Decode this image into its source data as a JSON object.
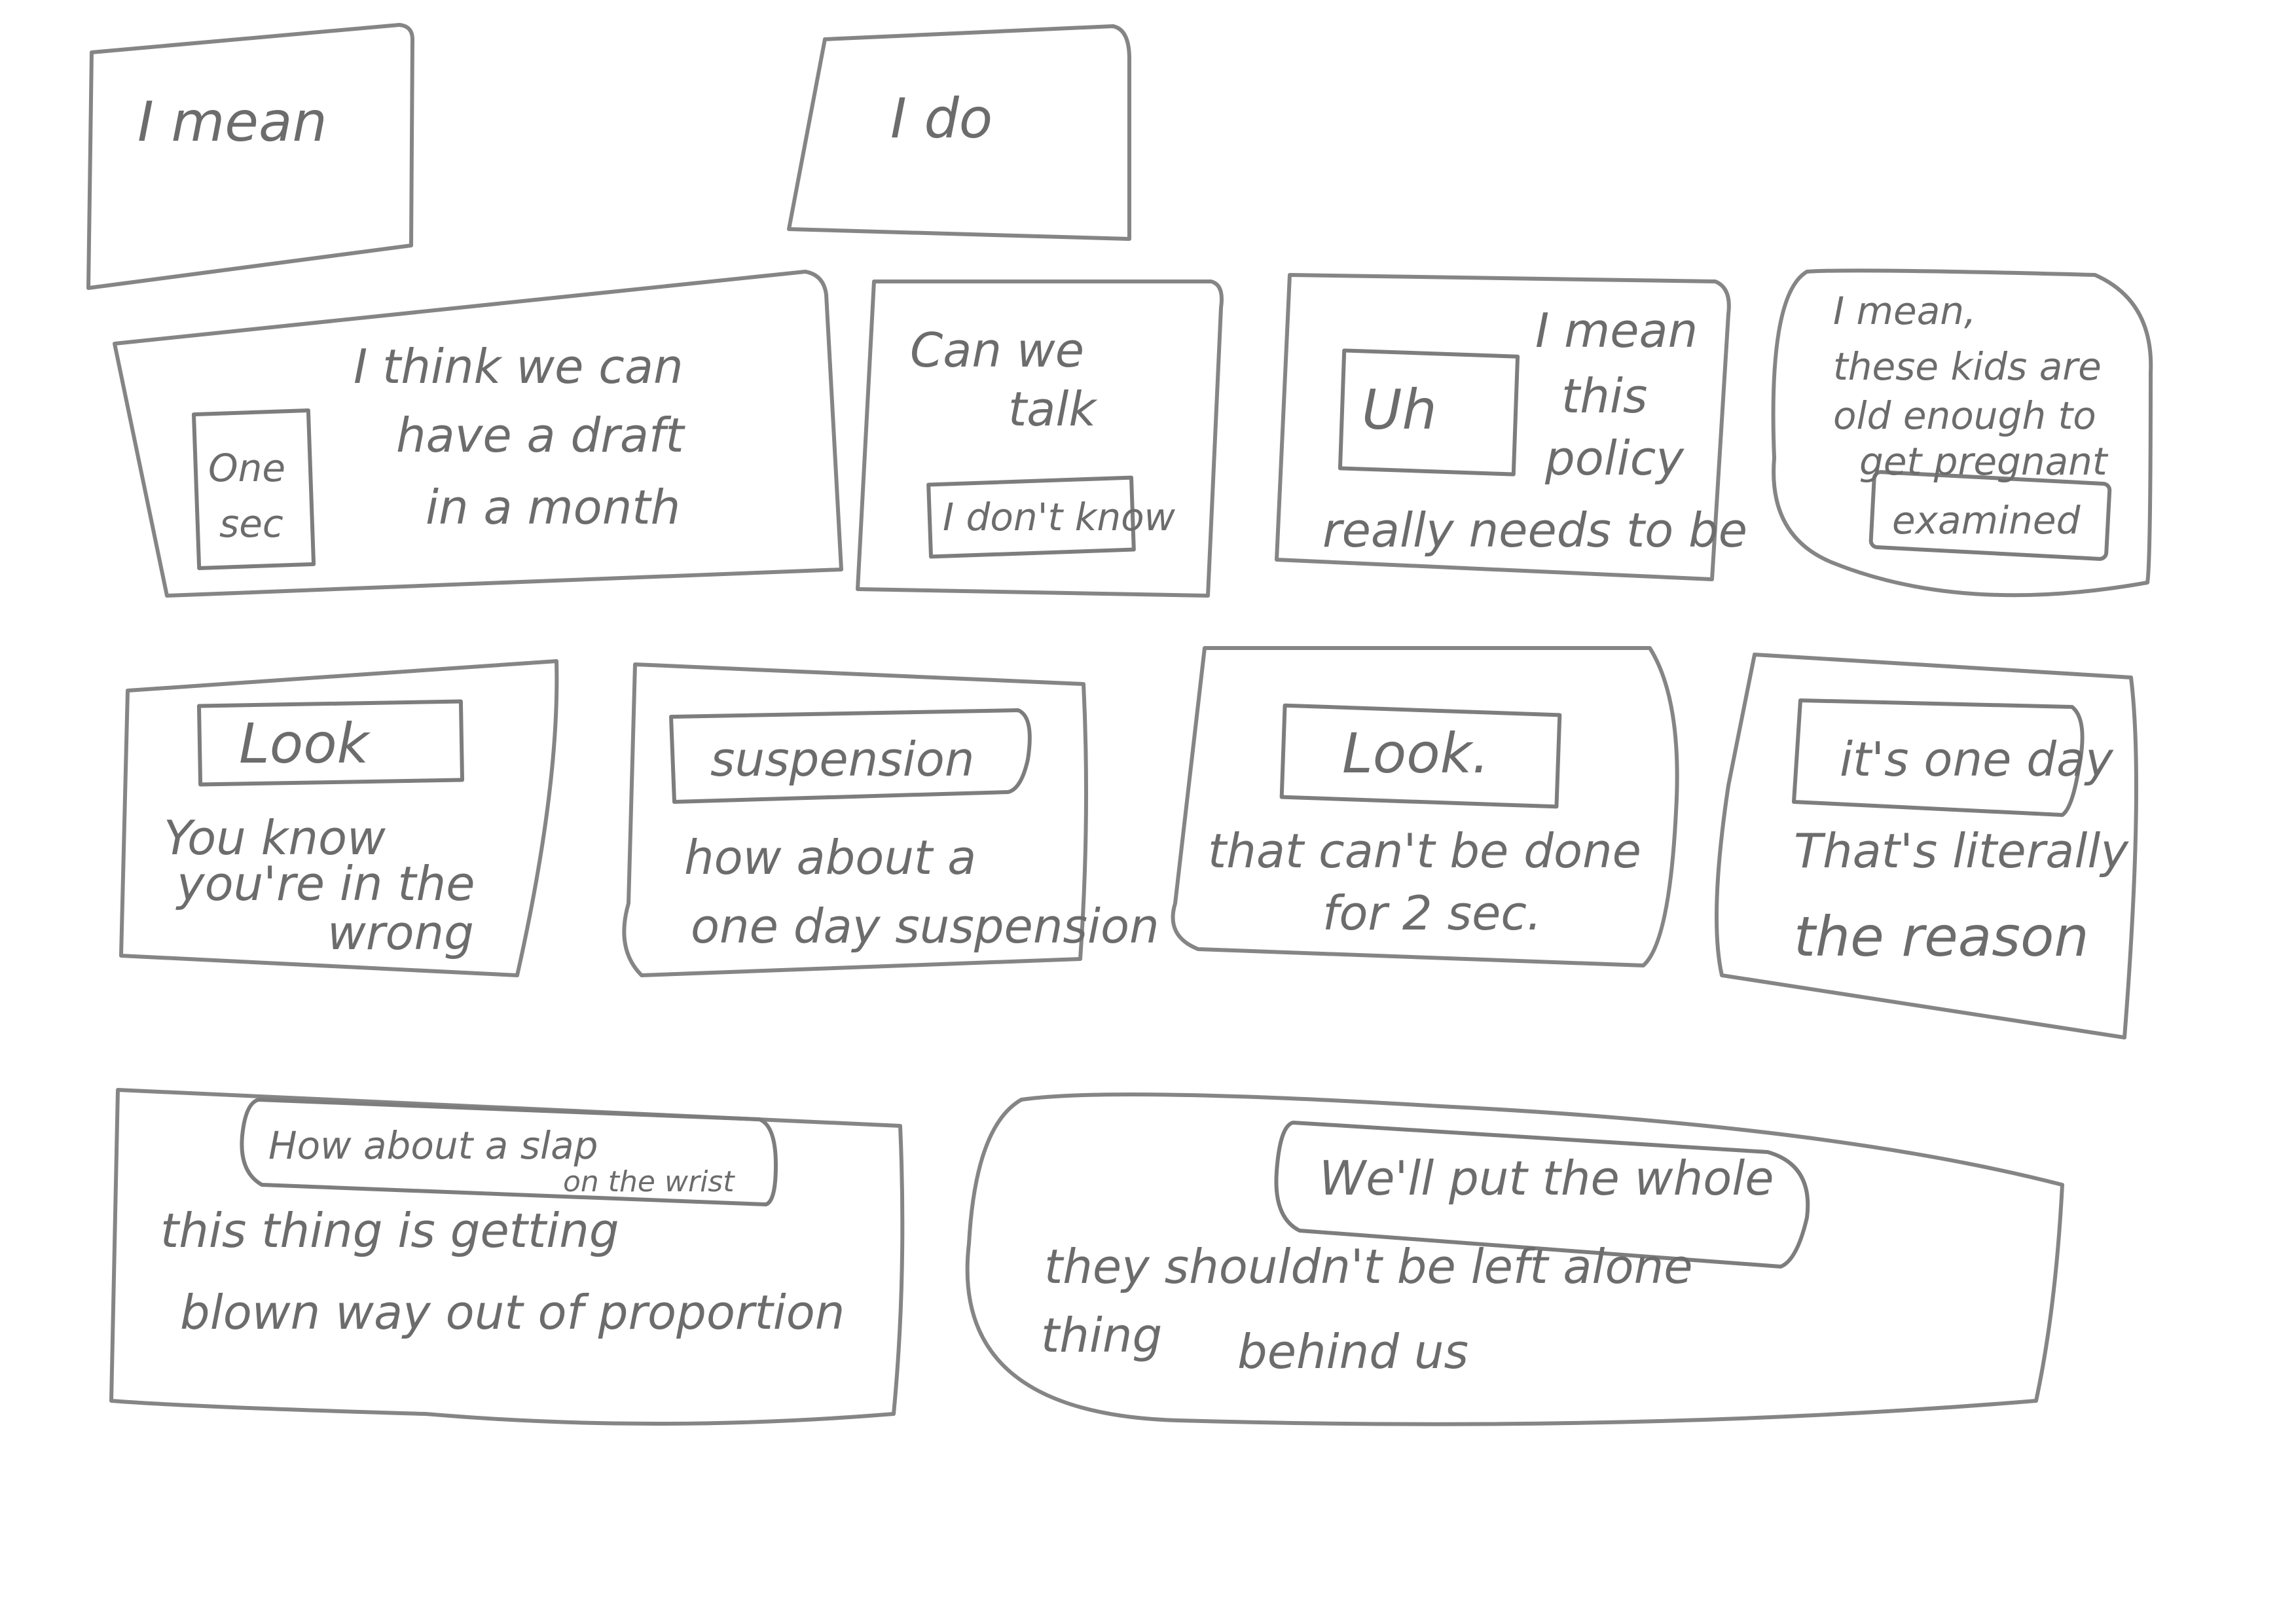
{
  "panels": [
    {
      "id": "p1",
      "lines": [
        "I mean"
      ]
    },
    {
      "id": "p2",
      "lines": [
        "I do"
      ]
    },
    {
      "id": "p3",
      "lines": [
        "I think we can",
        "have a draft",
        "in a month"
      ],
      "inset": [
        "One",
        "sec"
      ]
    },
    {
      "id": "p4",
      "lines": [
        "Can we",
        "talk"
      ],
      "inset": [
        "I don't know"
      ]
    },
    {
      "id": "p5",
      "lines": [
        "I mean",
        "this",
        "policy",
        "really needs to be"
      ],
      "inset": [
        "Uh"
      ]
    },
    {
      "id": "p6",
      "lines": [
        "I mean,",
        "these kids are",
        "old enough to",
        "get pregnant"
      ],
      "inset": [
        "examined"
      ]
    },
    {
      "id": "p7",
      "lines": [
        "You know",
        "you're in the",
        "wrong"
      ],
      "inset": [
        "Look"
      ]
    },
    {
      "id": "p8",
      "lines": [
        "how about a",
        "one day suspension"
      ],
      "inset": [
        "suspension"
      ]
    },
    {
      "id": "p9",
      "lines": [
        "that can't be done",
        "for 2 sec."
      ],
      "inset": [
        "Look."
      ]
    },
    {
      "id": "p10",
      "lines": [
        "That's literally",
        "the reason"
      ],
      "inset": [
        "it's one day"
      ]
    },
    {
      "id": "p11",
      "lines": [
        "this thing is getting",
        "blown way out of proportion"
      ],
      "inset": [
        "How about a slap",
        "on the wrist"
      ]
    },
    {
      "id": "p12",
      "lines": [
        "they shouldn't be left alone",
        "thing",
        "behind us"
      ],
      "inset": [
        "We'll put the whole"
      ]
    }
  ]
}
